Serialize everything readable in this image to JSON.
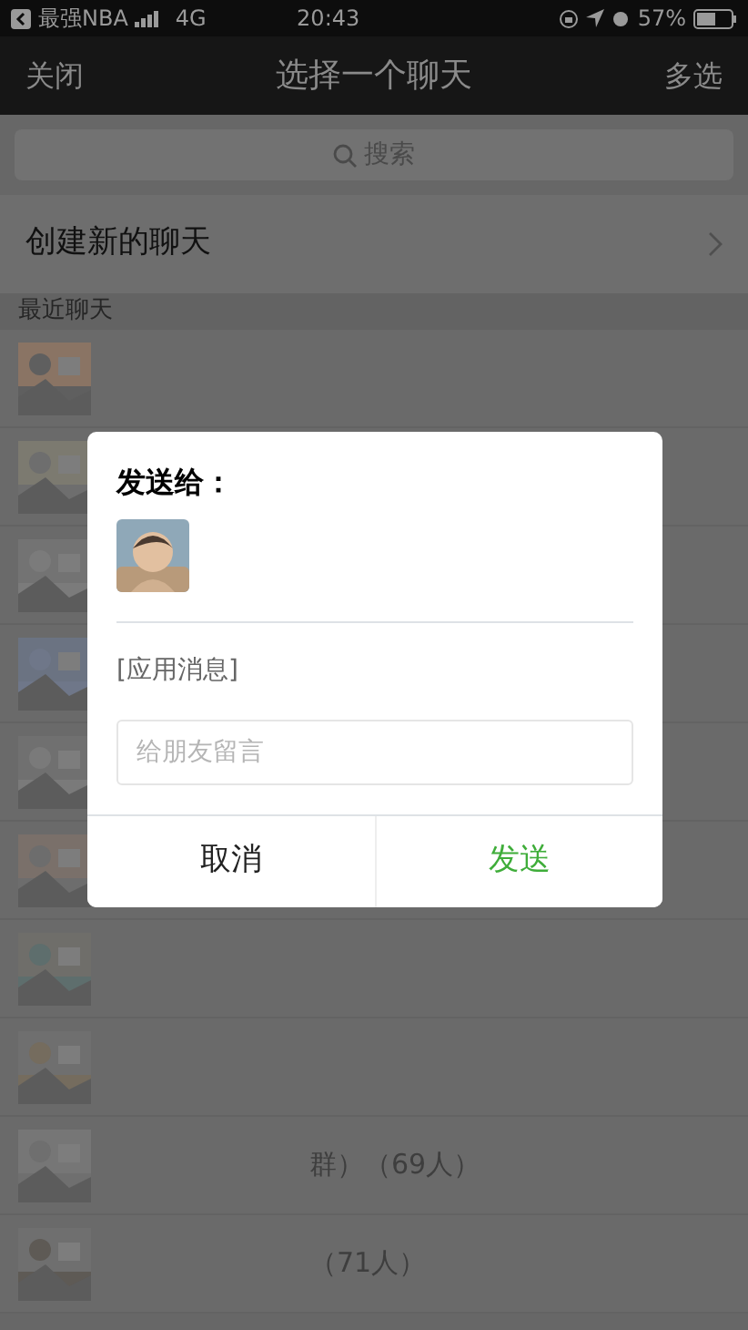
{
  "status_bar": {
    "back_label": "最强NBA",
    "network": "4G",
    "time": "20:43",
    "battery": "57%"
  },
  "nav": {
    "left": "关闭",
    "title": "选择一个聊天",
    "right": "多选"
  },
  "search": {
    "placeholder": "搜索"
  },
  "create_chat": {
    "label": "创建新的聊天"
  },
  "section_label": "最近聊天",
  "chats": [
    {
      "kind": "picture"
    },
    {
      "kind": "picture"
    },
    {
      "kind": "picture"
    },
    {
      "kind": "picture"
    },
    {
      "kind": "picture"
    },
    {
      "kind": "picture"
    },
    {
      "kind": "picture"
    },
    {
      "kind": "picture"
    },
    {
      "kind": "picture",
      "name": "群）（69人）"
    },
    {
      "kind": "picture",
      "name": "（71人）"
    }
  ],
  "dialog": {
    "title": "发送给：",
    "message": "[应用消息]",
    "input": {
      "placeholder": "给朋友留言"
    },
    "buttons": [
      {
        "label": "取消",
        "kind": "cancel"
      },
      {
        "label": "发送",
        "kind": "confirm"
      }
    ]
  }
}
